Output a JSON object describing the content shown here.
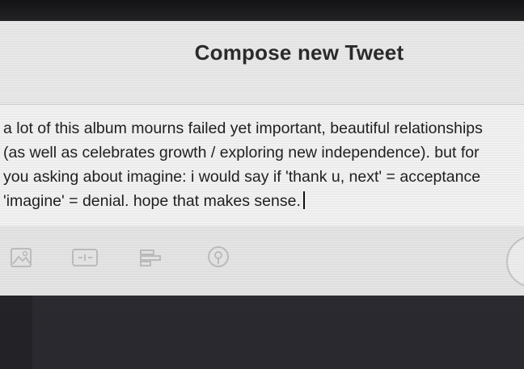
{
  "dialog": {
    "title": "Compose new Tweet"
  },
  "composer": {
    "lines": [
      "a lot of this album mourns failed yet important, beautiful relationships",
      "(as well as celebrates growth / exploring new independence). but for",
      "you asking about imagine: i would say if 'thank u, next' = acceptance",
      "'imagine' = denial. hope that makes sense."
    ]
  },
  "toolbar": {
    "icons": [
      "image-icon",
      "gif-icon",
      "poll-icon",
      "location-icon"
    ]
  },
  "colors": {
    "dialog_bg": "#e6e6e6",
    "textarea_bg": "#f1f1f1",
    "text": "#1f1f1f",
    "dark_bg": "#2b2a30"
  }
}
